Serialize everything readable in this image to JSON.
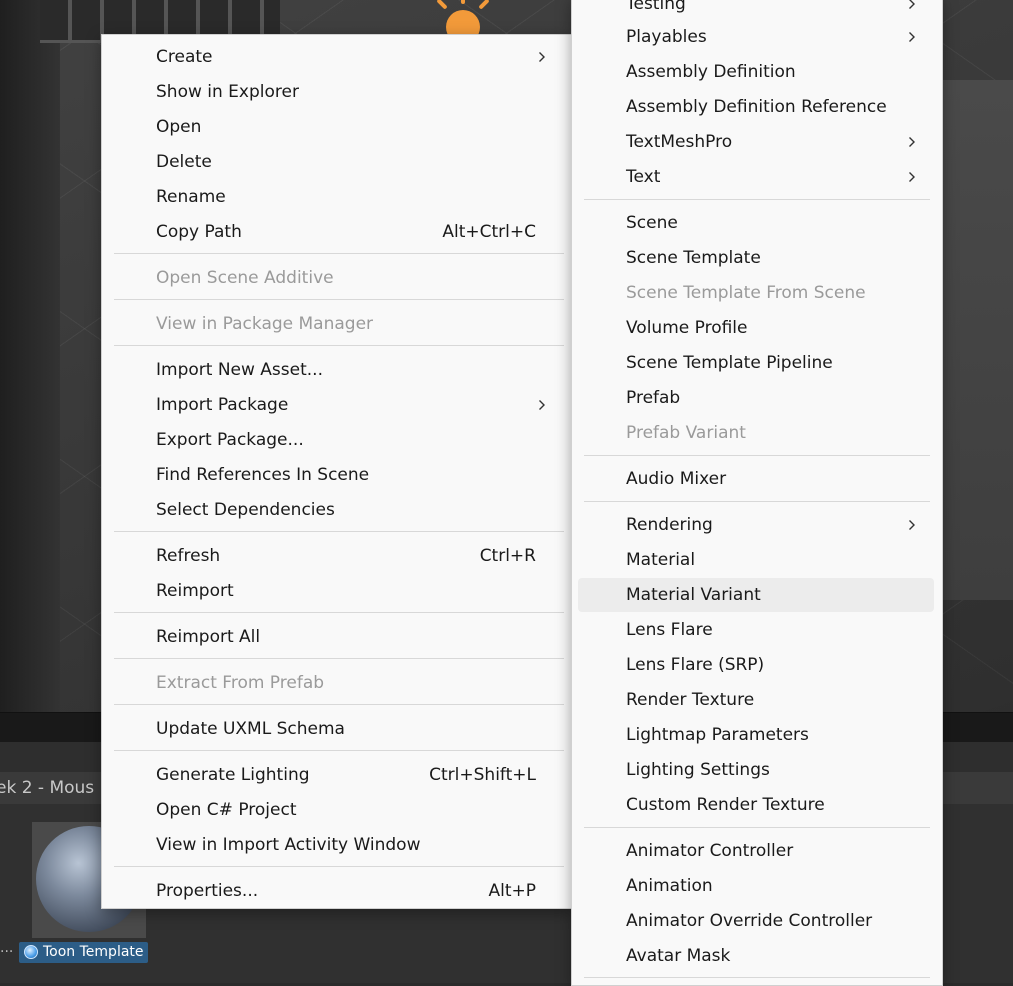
{
  "project_panel": {
    "breadcrumb_fragment": "ek 2 - Mous",
    "asset_name": "Toon Template",
    "ellipsis": "..."
  },
  "context_menu": {
    "items": [
      {
        "label": "Create",
        "submenu": true
      },
      {
        "label": "Show in Explorer"
      },
      {
        "label": "Open"
      },
      {
        "label": "Delete"
      },
      {
        "label": "Rename"
      },
      {
        "label": "Copy Path",
        "shortcut": "Alt+Ctrl+C"
      },
      {
        "label": "Open Scene Additive",
        "disabled": true
      },
      {
        "label": "View in Package Manager",
        "disabled": true
      },
      {
        "label": "Import New Asset..."
      },
      {
        "label": "Import Package",
        "submenu": true
      },
      {
        "label": "Export Package..."
      },
      {
        "label": "Find References In Scene"
      },
      {
        "label": "Select Dependencies"
      },
      {
        "label": "Refresh",
        "shortcut": "Ctrl+R"
      },
      {
        "label": "Reimport"
      },
      {
        "label": "Reimport All"
      },
      {
        "label": "Extract From Prefab",
        "disabled": true
      },
      {
        "label": "Update UXML Schema"
      },
      {
        "label": "Generate Lighting",
        "shortcut": "Ctrl+Shift+L"
      },
      {
        "label": "Open C# Project"
      },
      {
        "label": "View in Import Activity Window"
      },
      {
        "label": "Properties...",
        "shortcut": "Alt+P"
      }
    ]
  },
  "create_submenu": {
    "items": [
      {
        "label": "Testing",
        "submenu": true
      },
      {
        "label": "Playables",
        "submenu": true
      },
      {
        "label": "Assembly Definition"
      },
      {
        "label": "Assembly Definition Reference"
      },
      {
        "label": "TextMeshPro",
        "submenu": true
      },
      {
        "label": "Text",
        "submenu": true
      },
      {
        "label": "Scene"
      },
      {
        "label": "Scene Template"
      },
      {
        "label": "Scene Template From Scene",
        "disabled": true
      },
      {
        "label": "Volume Profile"
      },
      {
        "label": "Scene Template Pipeline"
      },
      {
        "label": "Prefab"
      },
      {
        "label": "Prefab Variant",
        "disabled": true
      },
      {
        "label": "Audio Mixer"
      },
      {
        "label": "Rendering",
        "submenu": true
      },
      {
        "label": "Material"
      },
      {
        "label": "Material Variant",
        "highlighted": true
      },
      {
        "label": "Lens Flare"
      },
      {
        "label": "Lens Flare (SRP)"
      },
      {
        "label": "Render Texture"
      },
      {
        "label": "Lightmap Parameters"
      },
      {
        "label": "Lighting Settings"
      },
      {
        "label": "Custom Render Texture"
      },
      {
        "label": "Animator Controller"
      },
      {
        "label": "Animation"
      },
      {
        "label": "Animator Override Controller"
      },
      {
        "label": "Avatar Mask"
      }
    ]
  }
}
